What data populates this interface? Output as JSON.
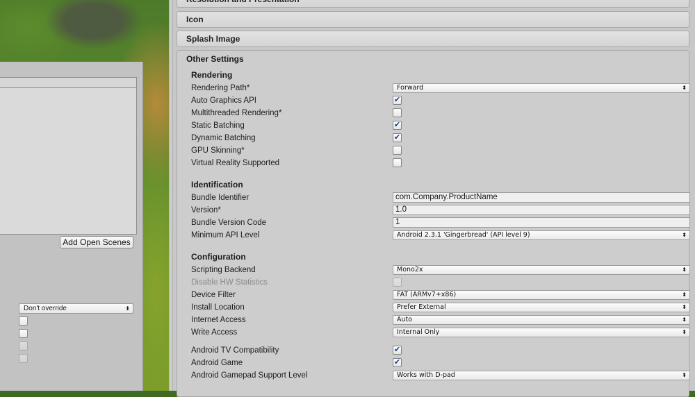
{
  "left_panel": {
    "add_open_scenes_label": "Add Open Scenes",
    "compression_dropdown_value": "Don't override"
  },
  "inspector": {
    "section_resolution": "Resolution and Presentation",
    "section_icon": "Icon",
    "section_splash": "Splash Image",
    "section_other": "Other Settings",
    "rendering": {
      "title": "Rendering",
      "rendering_path_label": "Rendering Path*",
      "rendering_path_value": "Forward",
      "auto_graphics_label": "Auto Graphics API",
      "auto_graphics_checked": true,
      "multithreaded_label": "Multithreaded Rendering*",
      "multithreaded_checked": false,
      "static_batching_label": "Static Batching",
      "static_batching_checked": true,
      "dynamic_batching_label": "Dynamic Batching",
      "dynamic_batching_checked": true,
      "gpu_skinning_label": "GPU Skinning*",
      "gpu_skinning_checked": false,
      "vr_label": "Virtual Reality Supported",
      "vr_checked": false
    },
    "identification": {
      "title": "Identification",
      "bundle_id_label": "Bundle Identifier",
      "bundle_id_value": "com.Company.ProductName",
      "version_label": "Version*",
      "version_value": "1.0",
      "bundle_version_code_label": "Bundle Version Code",
      "bundle_version_code_value": "1",
      "min_api_label": "Minimum API Level",
      "min_api_value": "Android 2.3.1 'Gingerbread' (API level 9)"
    },
    "configuration": {
      "title": "Configuration",
      "scripting_backend_label": "Scripting Backend",
      "scripting_backend_value": "Mono2x",
      "disable_hw_label": "Disable HW Statistics",
      "device_filter_label": "Device Filter",
      "device_filter_value": "FAT (ARMv7+x86)",
      "install_location_label": "Install Location",
      "install_location_value": "Prefer External",
      "internet_access_label": "Internet Access",
      "internet_access_value": "Auto",
      "write_access_label": "Write Access",
      "write_access_value": "Internal Only",
      "android_tv_label": "Android TV Compatibility",
      "android_game_label": "Android Game",
      "gamepad_label": "Android Gamepad Support Level",
      "gamepad_value": "Works with D-pad"
    },
    "checkmark_glyph": "✔",
    "dropdown_arrow_glyph": "⬍"
  }
}
